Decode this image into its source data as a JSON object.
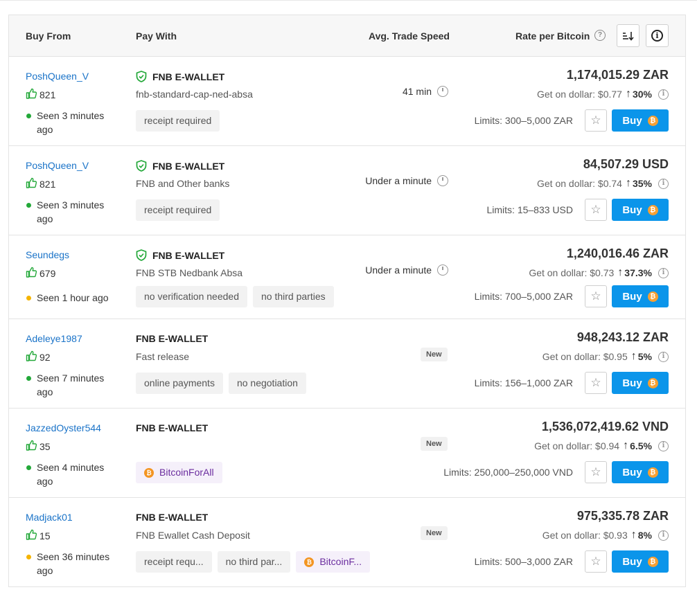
{
  "header": {
    "buy_from": "Buy From",
    "pay_with": "Pay With",
    "avg_speed": "Avg. Trade Speed",
    "rate": "Rate per Bitcoin",
    "help_glyph": "?",
    "info_glyph": "i"
  },
  "colors": {
    "link": "#1a73c8",
    "buy_button": "#0b95ea",
    "online_green": "#23a839",
    "away_yellow": "#f5b400",
    "bitcoin_orange": "#f39522"
  },
  "icons": {
    "thumbs": "thumbs-up-icon",
    "shield": "shield-check-icon",
    "clock": "clock-icon",
    "star": "star-icon",
    "btc": "bitcoin-icon",
    "sort": "sort-icon",
    "info": "info-icon"
  },
  "glyphs": {
    "star": "☆",
    "btc": "₿",
    "up_arrow": "↑",
    "info": "i"
  },
  "rows": [
    {
      "seller": "PoshQueen_V",
      "feedback": "821",
      "seen": "Seen 3 minutes ago",
      "status": "green",
      "method": "FNB E-WALLET",
      "verified": true,
      "desc": "fnb-standard-cap-ned-absa",
      "tags": [
        "receipt required"
      ],
      "speed": "41 min",
      "is_new": false,
      "price": "1,174,015.29 ZAR",
      "dollar": "Get on dollar: $0.77",
      "pct": "30%",
      "limits": "Limits: 300–5,000 ZAR",
      "buy": "Buy"
    },
    {
      "seller": "PoshQueen_V",
      "feedback": "821",
      "seen": "Seen 3 minutes ago",
      "status": "green",
      "method": "FNB E-WALLET",
      "verified": true,
      "desc": "FNB and Other banks",
      "tags": [
        "receipt required"
      ],
      "speed": "Under a minute",
      "is_new": false,
      "price": "84,507.29 USD",
      "dollar": "Get on dollar: $0.74",
      "pct": "35%",
      "limits": "Limits: 15–833 USD",
      "buy": "Buy"
    },
    {
      "seller": "Seundegs",
      "feedback": "679",
      "seen": "Seen 1 hour ago",
      "status": "yellow",
      "method": "FNB E-WALLET",
      "verified": true,
      "desc": "FNB STB Nedbank Absa",
      "tags": [
        "no verification needed",
        "no third parties"
      ],
      "speed": "Under a minute",
      "is_new": false,
      "price": "1,240,016.46 ZAR",
      "dollar": "Get on dollar: $0.73",
      "pct": "37.3%",
      "limits": "Limits: 700–5,000 ZAR",
      "buy": "Buy"
    },
    {
      "seller": "Adeleye1987",
      "feedback": "92",
      "seen": "Seen 7 minutes ago",
      "status": "green",
      "method": "FNB E-WALLET",
      "verified": false,
      "desc": "Fast release",
      "tags": [
        "online payments",
        "no negotiation"
      ],
      "speed": "",
      "is_new": true,
      "new_label": "New",
      "price": "948,243.12 ZAR",
      "dollar": "Get on dollar: $0.95",
      "pct": "5%",
      "limits": "Limits: 156–1,000 ZAR",
      "buy": "Buy"
    },
    {
      "seller": "JazzedOyster544",
      "feedback": "35",
      "seen": "Seen 4 minutes ago",
      "status": "green",
      "method": "FNB E-WALLET",
      "verified": false,
      "desc": "",
      "tags": [],
      "btc_tags": [
        "BitcoinForAll"
      ],
      "speed": "",
      "is_new": true,
      "new_label": "New",
      "price": "1,536,072,419.62 VND",
      "dollar": "Get on dollar: $0.94",
      "pct": "6.5%",
      "limits": "Limits: 250,000–250,000 VND",
      "buy": "Buy"
    },
    {
      "seller": "Madjack01",
      "feedback": "15",
      "seen": "Seen 36 minutes ago",
      "status": "yellow",
      "method": "FNB E-WALLET",
      "verified": false,
      "desc": "FNB Ewallet Cash Deposit",
      "tags": [
        "receipt requ...",
        "no third par..."
      ],
      "btc_tags": [
        "BitcoinF..."
      ],
      "speed": "",
      "is_new": true,
      "new_label": "New",
      "price": "975,335.78 ZAR",
      "dollar": "Get on dollar: $0.93",
      "pct": "8%",
      "limits": "Limits: 500–3,000 ZAR",
      "buy": "Buy"
    }
  ]
}
